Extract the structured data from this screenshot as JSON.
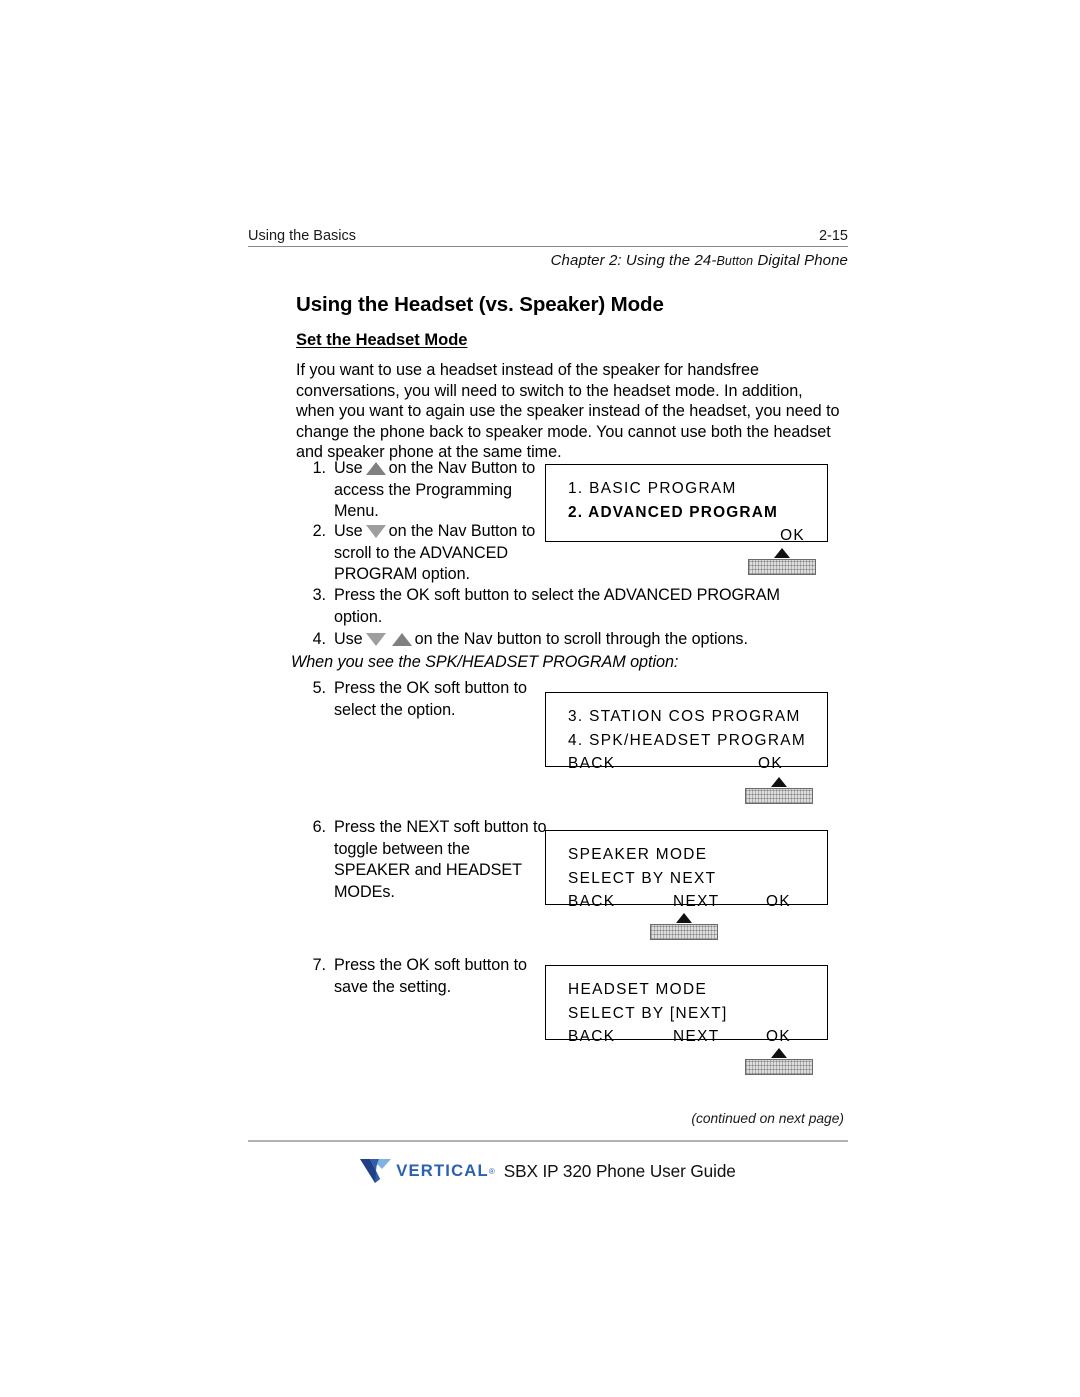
{
  "header": {
    "left": "Using the Basics",
    "page_number": "2-15",
    "chapter_prefix": "Chapter 2: Using the 24-",
    "chapter_button": "Button",
    "chapter_suffix": " Digital Phone"
  },
  "titles": {
    "h1": "Using the Headset (vs. Speaker) Mode",
    "h2": "Set the Headset Mode"
  },
  "intro": "If you want to use a headset instead of the speaker for handsfree conversations, you will need to switch to the headset mode. In addition, when you want to again use the speaker instead of the headset, you need to change the phone back to speaker mode. You cannot use both the headset and speaker phone at the same time.",
  "steps": {
    "s1": {
      "num": "1.",
      "pre": "Use",
      "icon": "nav-up-triangle-icon",
      "post": "on the Nav Button to access the Programming Menu."
    },
    "s2": {
      "num": "2.",
      "pre": "Use",
      "icon": "nav-down-triangle-icon",
      "post": "on the Nav Button to scroll to the ADVANCED PROGRAM option."
    },
    "s3": {
      "num": "3.",
      "text": "Press the OK soft button to select the ADVANCED PROGRAM option."
    },
    "s4": {
      "num": "4.",
      "pre": "Use",
      "icon1": "nav-down-triangle-icon",
      "icon2": "nav-up-triangle-icon",
      "post": "on the Nav button to scroll through the options."
    },
    "s5": {
      "num": "5.",
      "text": "Press the OK soft button to select the option."
    },
    "s6": {
      "num": "6.",
      "text": "Press the NEXT soft button to toggle between the SPEAKER and HEADSET MODEs."
    },
    "s7": {
      "num": "7.",
      "text": "Press the OK soft button to save the setting."
    }
  },
  "note": "When you see the SPK/HEADSET PROGRAM option:",
  "lcd_panels": [
    {
      "name": "programming-menu-display",
      "line1": "1. BASIC PROGRAM",
      "line2": "2. ADVANCED PROGRAM",
      "line2_bold": true,
      "softkeys": [
        "OK"
      ]
    },
    {
      "name": "advanced-program-display",
      "line1": "3. STATION COS PROGRAM",
      "line2": "4. SPK/HEADSET PROGRAM",
      "softkeys": [
        "BACK",
        "OK"
      ]
    },
    {
      "name": "speaker-mode-display",
      "line1": "SPEAKER MODE",
      "line2": "SELECT BY NEXT",
      "softkeys": [
        "BACK",
        "NEXT",
        "OK"
      ]
    },
    {
      "name": "headset-mode-display",
      "line1": "HEADSET MODE",
      "line2": "SELECT BY [NEXT]",
      "softkeys": [
        "BACK",
        "NEXT",
        "OK"
      ]
    }
  ],
  "footer": {
    "continued": "(continued on next page)",
    "logo_word": "VERTICAL",
    "logo_tm": "®",
    "title": "SBX IP 320 Phone User Guide"
  },
  "colors": {
    "rule": "#8a8a8a",
    "footer_rule": "#b3b3b3",
    "triangle_up": "#808080",
    "triangle_down": "#9e9e9e",
    "logo_dark_blue": "#1f3f87",
    "logo_light_blue": "#6fa8dc",
    "logo_text_blue": "#2a62b0"
  }
}
